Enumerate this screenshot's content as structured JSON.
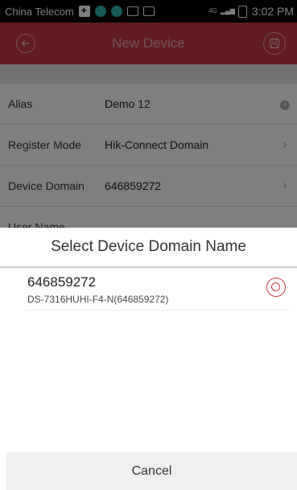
{
  "status_bar": {
    "carrier": "China Telecom",
    "network": "4G",
    "time": "3:02 PM"
  },
  "header": {
    "title": "New Device",
    "back_icon": "back-arrow-icon",
    "save_icon": "save-icon"
  },
  "form": {
    "rows": [
      {
        "label": "Alias",
        "value": "Demo 12"
      },
      {
        "label": "Register Mode",
        "value": "Hik-Connect Domain"
      },
      {
        "label": "Device Domain",
        "value": "646859272"
      },
      {
        "label": "User Name",
        "value": ""
      }
    ]
  },
  "dialog": {
    "title": "Select Device Domain Name",
    "items": [
      {
        "name": "646859272",
        "description": "DS-7316HUHI-F4-N(646859272)",
        "selected": true
      }
    ],
    "cancel_label": "Cancel"
  },
  "colors": {
    "accent": "#c43a3f",
    "overlay": "#000000"
  }
}
